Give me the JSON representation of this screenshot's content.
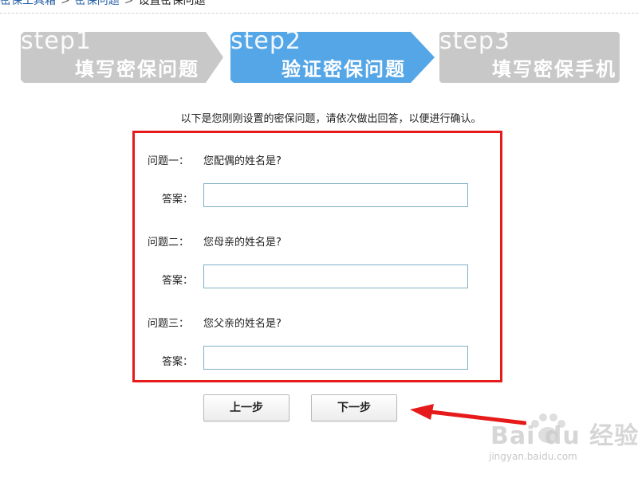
{
  "breadcrumb": {
    "items": [
      "密保工具箱",
      "密保问题"
    ],
    "separator": ">",
    "current": "设置密保问题"
  },
  "steps": [
    {
      "number": "step1",
      "title": "填写密保问题",
      "state": "done",
      "color": "#c8c8c8"
    },
    {
      "number": "step2",
      "title": "验证密保问题",
      "state": "active",
      "color": "#55a6e6"
    },
    {
      "number": "step3",
      "title": "填写密保手机",
      "state": "pending",
      "color": "#c8c8c8"
    }
  ],
  "instruction": "以下是您刚刚设置的密保问题，请依次做出回答，以便进行确认。",
  "questions": [
    {
      "prefix": "问题一：",
      "text": "您配偶的姓名是?",
      "answer_label": "答案：",
      "answer_value": ""
    },
    {
      "prefix": "问题二：",
      "text": "您母亲的姓名是?",
      "answer_label": "答案：",
      "answer_value": ""
    },
    {
      "prefix": "问题三：",
      "text": "您父亲的姓名是?",
      "answer_label": "答案：",
      "answer_value": ""
    }
  ],
  "buttons": {
    "prev": "上一步",
    "next": "下一步"
  },
  "watermark": {
    "main": "Bai du 经验",
    "sub": "jingyan.baidu.com"
  },
  "colors": {
    "highlight_border": "#e61a1a",
    "arrow": "#e61a1a",
    "link": "#2a62a8",
    "input_border": "#7fb0c7"
  }
}
